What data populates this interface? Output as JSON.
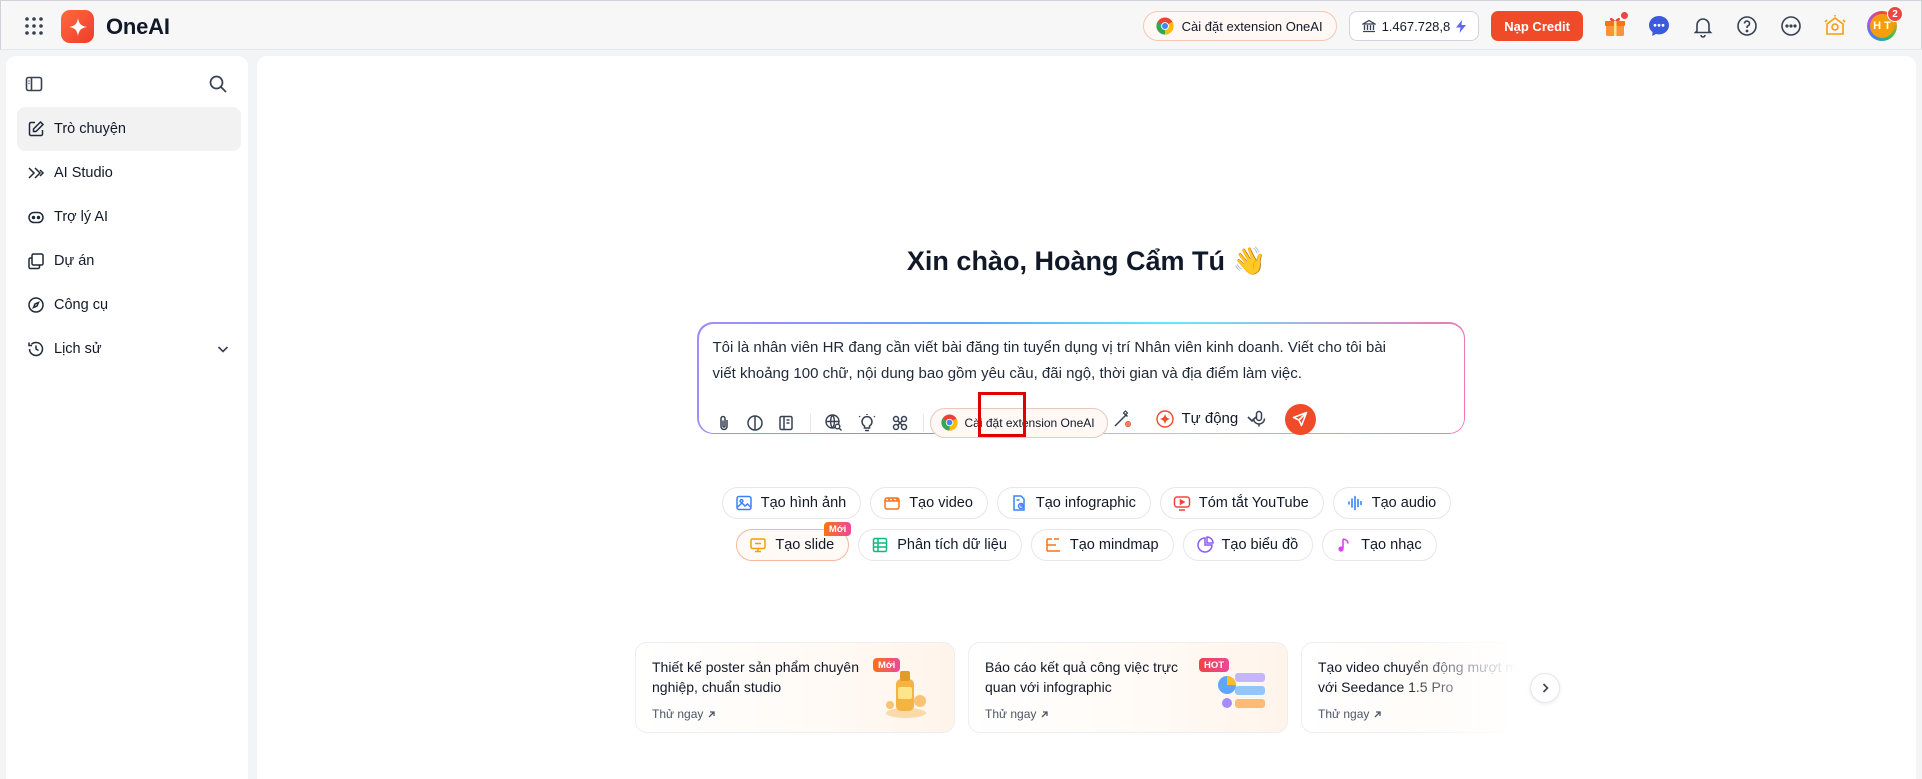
{
  "app": {
    "name": "OneAI"
  },
  "topbar": {
    "extension_label": "Cài đặt extension OneAI",
    "credit_value": "1.467.728,8",
    "topup_label": "Nạp Credit",
    "avatar_initials": "H T",
    "notification_count": "2"
  },
  "sidebar": {
    "items": [
      {
        "label": "Trò chuyện",
        "icon": "chat-edit-icon",
        "active": true
      },
      {
        "label": "AI Studio",
        "icon": "studio-icon"
      },
      {
        "label": "Trợ lý AI",
        "icon": "robot-icon"
      },
      {
        "label": "Dự án",
        "icon": "folder-icon"
      },
      {
        "label": "Công cụ",
        "icon": "compass-icon"
      },
      {
        "label": "Lịch sử",
        "icon": "history-icon",
        "expandable": true
      }
    ]
  },
  "main": {
    "greeting": "Xin chào, Hoàng Cẩm Tú 👋",
    "composer": {
      "text": "Tôi là nhân viên HR đang cần viết bài đăng tin tuyển dụng vị trí Nhân viên kinh doanh. Viết cho tôi bài viết khoảng 100 chữ, nội dung bao gồm yêu cầu, đãi ngộ, thời gian và địa điểm làm việc.",
      "extension_label": "Cài đặt extension OneAI",
      "mode_label": "Tự động"
    },
    "chips_row1": [
      {
        "label": "Tạo hình ảnh",
        "icon": "image-icon",
        "color": "#3b82f6"
      },
      {
        "label": "Tạo video",
        "icon": "video-icon",
        "color": "#f97316"
      },
      {
        "label": "Tạo infographic",
        "icon": "infographic-icon",
        "color": "#3b82f6"
      },
      {
        "label": "Tóm tắt YouTube",
        "icon": "youtube-icon",
        "color": "#ef4444"
      },
      {
        "label": "Tạo audio",
        "icon": "audio-icon",
        "color": "#3b82f6"
      }
    ],
    "chips_row2": [
      {
        "label": "Tạo slide",
        "icon": "slide-icon",
        "color": "#f59e0b",
        "tag": "Mới"
      },
      {
        "label": "Phân tích dữ liệu",
        "icon": "data-icon",
        "color": "#10b981"
      },
      {
        "label": "Tạo mindmap",
        "icon": "mindmap-icon",
        "color": "#f97316"
      },
      {
        "label": "Tạo biểu đồ",
        "icon": "chart-icon",
        "color": "#8b5cf6"
      },
      {
        "label": "Tạo nhạc",
        "icon": "music-icon",
        "color": "#d946ef"
      }
    ],
    "cards": [
      {
        "title": "Thiết kế poster sản phẩm chuyên nghiệp, chuẩn studio",
        "link": "Thử ngay",
        "tag": "Mới"
      },
      {
        "title": "Báo cáo kết quả công việc trực quan với infographic",
        "link": "Thử ngay",
        "tag": "HOT"
      },
      {
        "title": "Tạo video chuyển động mượt mà với Seedance 1.5 Pro",
        "link": "Thử ngay"
      }
    ]
  },
  "colors": {
    "accent": "#ef4b28",
    "highlight": "#e00000"
  }
}
